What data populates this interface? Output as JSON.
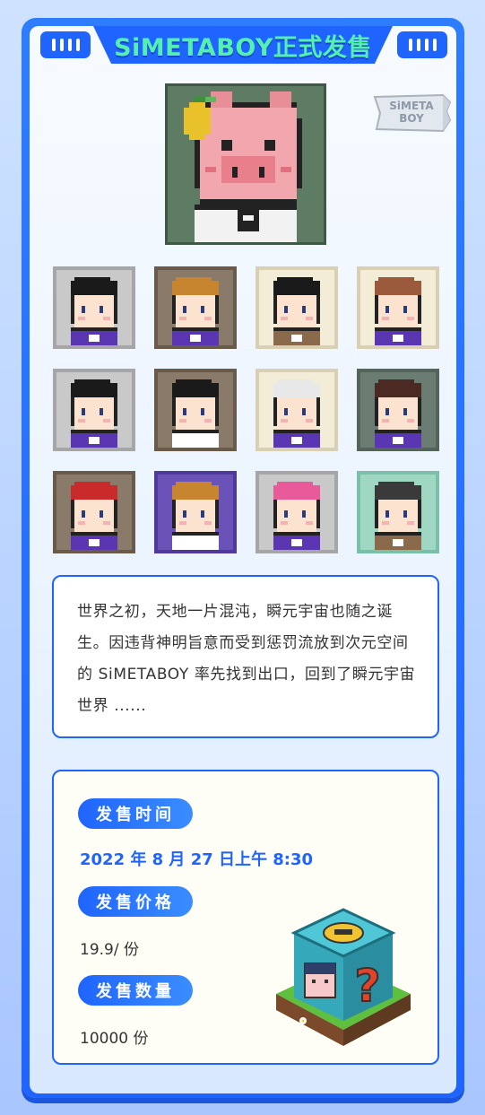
{
  "header": {
    "title": "SiMETABOY正式发售"
  },
  "badge": {
    "line1": "SiMETA",
    "line2": "BOY"
  },
  "story": {
    "text": "世界之初，天地一片混沌，瞬元宇宙也随之诞生。因违背神明旨意而受到惩罚流放到次元空间的 SiMETABOY 率先找到出口，回到了瞬元宇宙世界 ......"
  },
  "sale": {
    "time_label": "发售时间",
    "time_value": "2022 年 8 月 27 日上午 8:30",
    "price_label": "发售价格",
    "price_value": "19.9/ 份",
    "qty_label": "发售数量",
    "qty_value": "10000 份"
  },
  "colors": {
    "brand_blue": "#1f64ff",
    "title_green": "#54f0b0"
  },
  "avatars": [
    {
      "bg": "#c9c9c9",
      "border": "#a6a6a6",
      "hair": "#1a1a1a",
      "shirt": "#5b36b3",
      "skin": "#fbe3cf",
      "name": "avatar-spiky-black"
    },
    {
      "bg": "#8a7a6a",
      "border": "#6a5a4a",
      "hair": "#c6852e",
      "shirt": "#5b36b3",
      "skin": "#fbe3cf",
      "name": "avatar-strawberry"
    },
    {
      "bg": "#f3ecd6",
      "border": "#d8cfb4",
      "hair": "#1a1a1a",
      "shirt": "#8a6a4a",
      "skin": "#fbe3cf",
      "name": "avatar-mask"
    },
    {
      "bg": "#f3ecd6",
      "border": "#d8cfb4",
      "hair": "#9c5a3c",
      "shirt": "#5b36b3",
      "skin": "#fbe3cf",
      "name": "avatar-cowboy"
    },
    {
      "bg": "#c9c9c9",
      "border": "#a6a6a6",
      "hair": "#1a1a1a",
      "shirt": "#5b36b3",
      "skin": "#fbe3cf",
      "name": "avatar-sword"
    },
    {
      "bg": "#8a7a6a",
      "border": "#6a5a4a",
      "hair": "#1a1a1a",
      "shirt": "#ffffff",
      "skin": "#fbe3cf",
      "name": "avatar-skull"
    },
    {
      "bg": "#f3ecd6",
      "border": "#d8cfb4",
      "hair": "#e8e8e8",
      "shirt": "#5b36b3",
      "skin": "#fbe3cf",
      "name": "avatar-white-hair"
    },
    {
      "bg": "#6b7d72",
      "border": "#54645a",
      "hair": "#4a2a22",
      "shirt": "#5b36b3",
      "skin": "#fbe3cf",
      "name": "avatar-brown-hair"
    },
    {
      "bg": "#8a7a6a",
      "border": "#6a5a4a",
      "hair": "#c92a2a",
      "shirt": "#5b36b3",
      "skin": "#fbe3cf",
      "name": "avatar-mushroom"
    },
    {
      "bg": "#6a52b8",
      "border": "#4f3a99",
      "hair": "#c6852e",
      "shirt": "#ffffff",
      "skin": "#fbe3cf",
      "name": "avatar-blond"
    },
    {
      "bg": "#c9c9c9",
      "border": "#a6a6a6",
      "hair": "#e85a9a",
      "shirt": "#5b36b3",
      "skin": "#fbe3cf",
      "name": "avatar-pink-cap"
    },
    {
      "bg": "#9fd7c3",
      "border": "#7cbfa8",
      "hair": "#3a3a3a",
      "shirt": "#8a6a4a",
      "skin": "#fbe3cf",
      "name": "avatar-cat-ears"
    }
  ]
}
